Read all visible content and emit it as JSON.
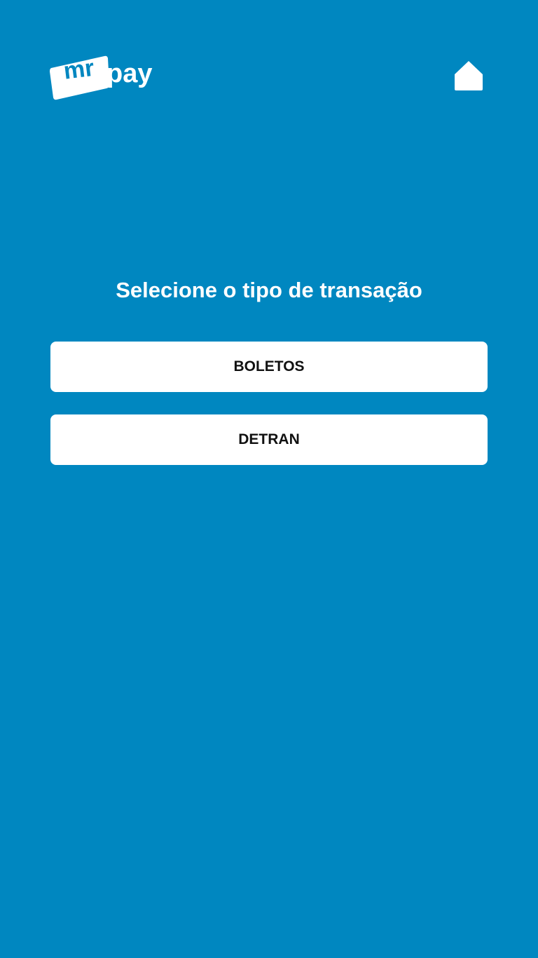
{
  "brand": {
    "logo_part1": "mr",
    "logo_part2": "pay"
  },
  "header": {
    "home_icon": "home-icon"
  },
  "main": {
    "title": "Selecione o tipo de transação",
    "options": [
      {
        "label": "BOLETOS"
      },
      {
        "label": "DETRAN"
      }
    ]
  },
  "colors": {
    "background": "#0087c0",
    "button_bg": "#ffffff",
    "button_text": "#111111",
    "title_text": "#ffffff"
  }
}
